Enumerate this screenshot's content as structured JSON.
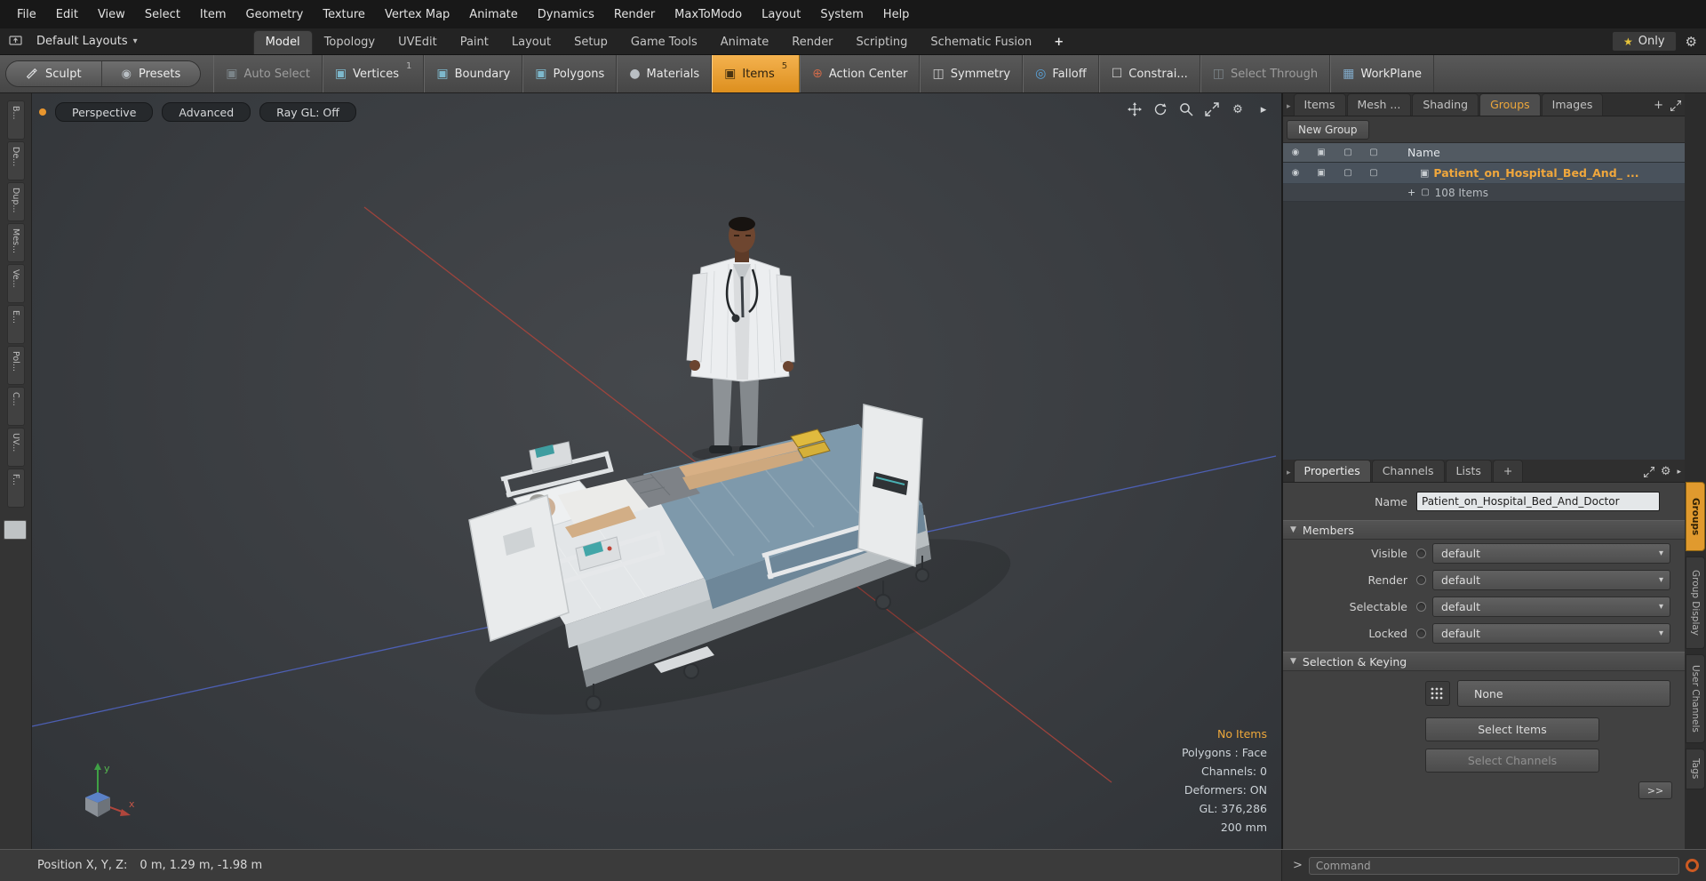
{
  "colors": {
    "accent": "#eda73b",
    "axis_red": "#a8443c",
    "axis_blue": "#5166c8"
  },
  "menubar": {
    "items": [
      "File",
      "Edit",
      "View",
      "Select",
      "Item",
      "Geometry",
      "Texture",
      "Vertex Map",
      "Animate",
      "Dynamics",
      "Render",
      "MaxToModo",
      "Layout",
      "System",
      "Help"
    ]
  },
  "layoutbar": {
    "layout_switcher": "Default Layouts",
    "tabs": [
      "Model",
      "Topology",
      "UVEdit",
      "Paint",
      "Layout",
      "Setup",
      "Game Tools",
      "Animate",
      "Render",
      "Scripting",
      "Schematic Fusion"
    ],
    "only_button": "Only"
  },
  "toolbar": {
    "sculpt": "Sculpt",
    "presets": "Presets",
    "buttons": [
      {
        "label": "Auto Select"
      },
      {
        "label": "Vertices",
        "badge": "1"
      },
      {
        "label": "Boundary"
      },
      {
        "label": "Polygons"
      },
      {
        "label": "Materials"
      },
      {
        "label": "Items",
        "badge": "5"
      },
      {
        "label": "Action Center"
      },
      {
        "label": "Symmetry"
      },
      {
        "label": "Falloff"
      },
      {
        "label": "Constrai..."
      },
      {
        "label": "Select Through"
      },
      {
        "label": "WorkPlane"
      }
    ]
  },
  "left_tabs": [
    "B...",
    "De...",
    "Dup...",
    "Mes...",
    "Ve...",
    "E...",
    "Pol...",
    "C...",
    "UV...",
    "F..."
  ],
  "viewport": {
    "perspective": "Perspective",
    "advanced": "Advanced",
    "raygl": "Ray GL: Off",
    "info": {
      "no_items": "No Items",
      "polygons": "Polygons : Face",
      "channels": "Channels: 0",
      "deformers": "Deformers: ON",
      "gl": "GL: 376,286",
      "scale": "200 mm"
    },
    "axis": {
      "x": "x",
      "y": "y"
    }
  },
  "item_list": {
    "tabs": [
      "Items",
      "Mesh ...",
      "Shading",
      "Groups",
      "Images"
    ],
    "new_group": "New Group",
    "name_header": "Name",
    "group_name": "Patient_on_Hospital_Bed_And_ ...",
    "group_items": "108 Items"
  },
  "properties": {
    "tabs": [
      "Properties",
      "Channels",
      "Lists"
    ],
    "name_label": "Name",
    "name_value": "Patient_on_Hospital_Bed_And_Doctor",
    "members_section": "Members",
    "rows": [
      {
        "label": "Visible",
        "value": "default"
      },
      {
        "label": "Render",
        "value": "default"
      },
      {
        "label": "Selectable",
        "value": "default"
      },
      {
        "label": "Locked",
        "value": "default"
      }
    ],
    "selection_section": "Selection & Keying",
    "none_button": "None",
    "select_items": "Select Items",
    "select_channels": "Select Channels",
    "more_button": ">>"
  },
  "side_tabs": [
    "Groups",
    "Group Display",
    "User Channels",
    "Tags"
  ],
  "statusbar": {
    "position_label": "Position X, Y, Z:",
    "position_value": "0 m, 1.29 m, -1.98 m"
  },
  "command": {
    "prompt": ">",
    "placeholder": "Command"
  },
  "icons": {
    "dropdown_arrow": "▾",
    "star": "★",
    "gear": "⚙",
    "plus": "+",
    "section_arrow": "▼",
    "panel_arrow": "▸",
    "eye": "◉",
    "cube": "▣",
    "cube_outline": "▢",
    "sphere": "●",
    "falloff": "◎",
    "action_center": "⊕",
    "symmetry": "◫",
    "checkbox": "☐",
    "workplane": "▦",
    "preset": "◉"
  }
}
